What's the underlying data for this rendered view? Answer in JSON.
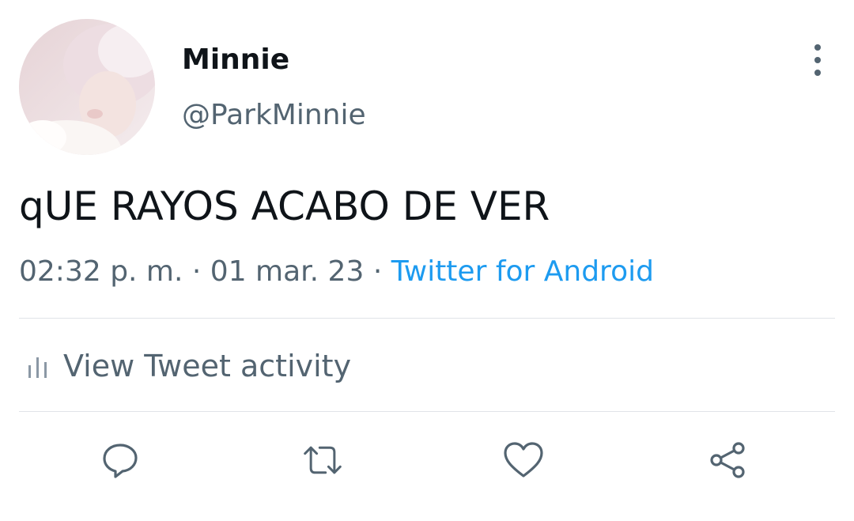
{
  "tweet": {
    "author_name": "Minnie",
    "author_handle": "@ParkMinnie",
    "text": "qUE RAYOS ACABO DE VER",
    "time": "02:32 p. m.",
    "separator": " · ",
    "date": "01 mar. 23",
    "source": "Twitter for Android"
  },
  "activity": {
    "label": "View Tweet activity",
    "icon": "bar-chart-icon"
  },
  "actions": [
    {
      "name": "reply",
      "icon": "reply-icon"
    },
    {
      "name": "retweet",
      "icon": "retweet-icon"
    },
    {
      "name": "like",
      "icon": "heart-icon"
    },
    {
      "name": "share",
      "icon": "share-icon"
    }
  ],
  "menu": {
    "icon": "more-vertical-icon"
  },
  "colors": {
    "text_primary": "#0f1419",
    "text_secondary": "#536471",
    "link": "#1d9bf0",
    "divider": "#e1e4e8"
  }
}
